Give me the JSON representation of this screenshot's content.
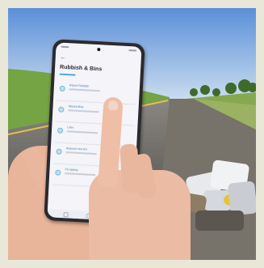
{
  "screen": {
    "title": "Rubbish & Bins",
    "items": [
      {
        "label": "Report Rubbish",
        "icon": "rubbish-icon"
      },
      {
        "label": "Missed Bins",
        "icon": "bin-icon"
      },
      {
        "label": "Litter",
        "icon": "litter-icon"
      },
      {
        "label": "Request new bin",
        "icon": "new-bin-icon"
      },
      {
        "label": "Fly tipping",
        "icon": "fly-tipping-icon"
      }
    ]
  },
  "colors": {
    "sky": "#7fa6dc",
    "grass": "#7aa64a",
    "road": "#5a5753",
    "accent": "#4aa6d8"
  }
}
